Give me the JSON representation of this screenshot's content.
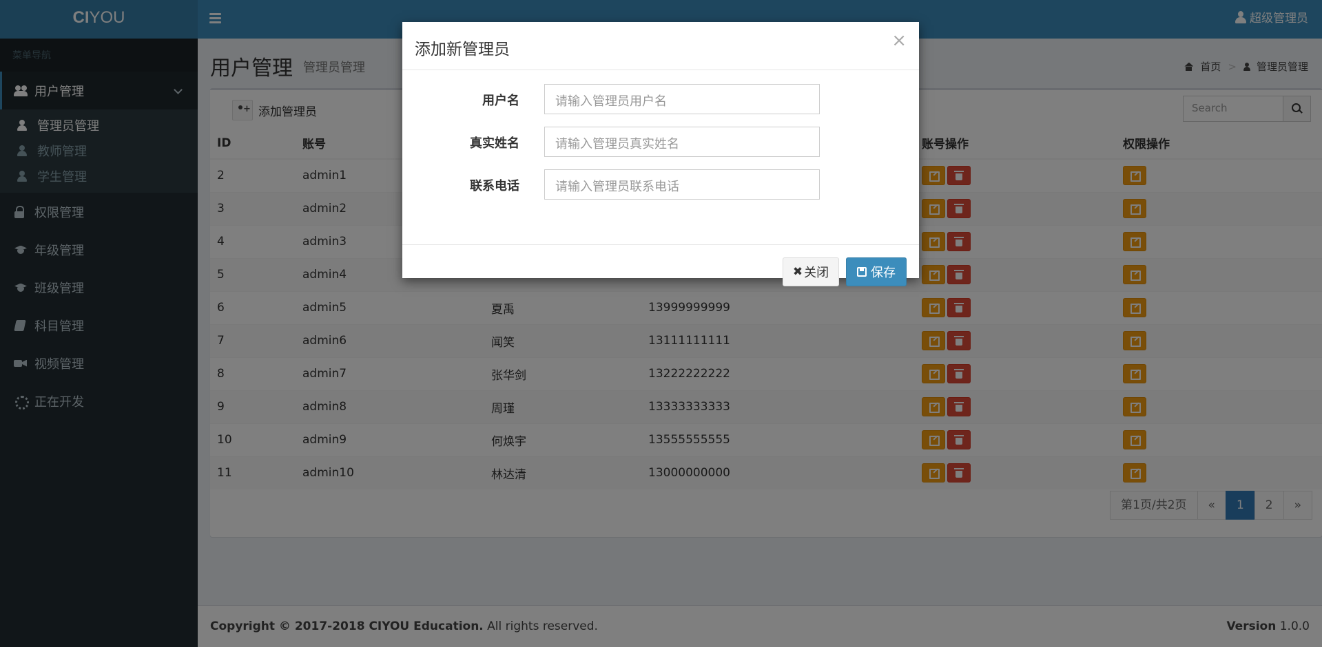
{
  "app": {
    "logo_bold": "CI",
    "logo_rest": "YOU",
    "user_name": "超级管理员"
  },
  "sidebar": {
    "header": "菜单导航",
    "items": [
      {
        "label": "用户管理",
        "icon": "users-icon"
      },
      {
        "label": "权限管理",
        "icon": "lock-icon"
      },
      {
        "label": "年级管理",
        "icon": "graduation-cap-icon"
      },
      {
        "label": "班级管理",
        "icon": "graduation-cap-icon"
      },
      {
        "label": "科目管理",
        "icon": "book-icon"
      },
      {
        "label": "视频管理",
        "icon": "video-camera-icon"
      },
      {
        "label": "正在开发",
        "icon": "spinner-icon"
      }
    ],
    "subitems": [
      {
        "label": "管理员管理"
      },
      {
        "label": "教师管理"
      },
      {
        "label": "学生管理"
      }
    ]
  },
  "page": {
    "title": "用户管理",
    "subtitle": "管理员管理",
    "breadcrumb_home": "首页",
    "breadcrumb_current": "管理员管理"
  },
  "toolbar": {
    "add_label": "添加管理员",
    "search_placeholder": "Search"
  },
  "table": {
    "headers": {
      "id": "ID",
      "account": "账号",
      "col3": "",
      "col4": "",
      "account_ops": "账号操作",
      "perm_ops": "权限操作"
    },
    "rows": [
      {
        "id": "2",
        "account": "admin1",
        "name": "",
        "phone": ""
      },
      {
        "id": "3",
        "account": "admin2",
        "name": "",
        "phone": ""
      },
      {
        "id": "4",
        "account": "admin3",
        "name": "",
        "phone": ""
      },
      {
        "id": "5",
        "account": "admin4",
        "name": "",
        "phone": ""
      },
      {
        "id": "6",
        "account": "admin5",
        "name": "夏禹",
        "phone": "13999999999"
      },
      {
        "id": "7",
        "account": "admin6",
        "name": "闻笑",
        "phone": "13111111111"
      },
      {
        "id": "8",
        "account": "admin7",
        "name": "张华剑",
        "phone": "13222222222"
      },
      {
        "id": "9",
        "account": "admin8",
        "name": "周瑾",
        "phone": "13333333333"
      },
      {
        "id": "10",
        "account": "admin9",
        "name": "何焕宇",
        "phone": "13555555555"
      },
      {
        "id": "11",
        "account": "admin10",
        "name": "林达清",
        "phone": "13000000000"
      }
    ]
  },
  "pagination": {
    "info": "第1页/共2页",
    "prev": "«",
    "pages": [
      "1",
      "2"
    ],
    "current": "1",
    "next": "»"
  },
  "footer": {
    "copyright_bold": "Copyright © 2017-2018 CIYOU Education.",
    "copyright_rest": " All rights reserved.",
    "version_label": "Version",
    "version_value": " 1.0.0"
  },
  "modal": {
    "title": "添加新管理员",
    "close_symbol": "×",
    "fields": [
      {
        "label": "用户名",
        "placeholder": "请输入管理员用户名"
      },
      {
        "label": "真实姓名",
        "placeholder": "请输入管理员真实姓名"
      },
      {
        "label": "联系电话",
        "placeholder": "请输入管理员联系电话"
      }
    ],
    "close_btn": "关闭",
    "close_btn_icon": "✖",
    "save_btn": "保存"
  }
}
